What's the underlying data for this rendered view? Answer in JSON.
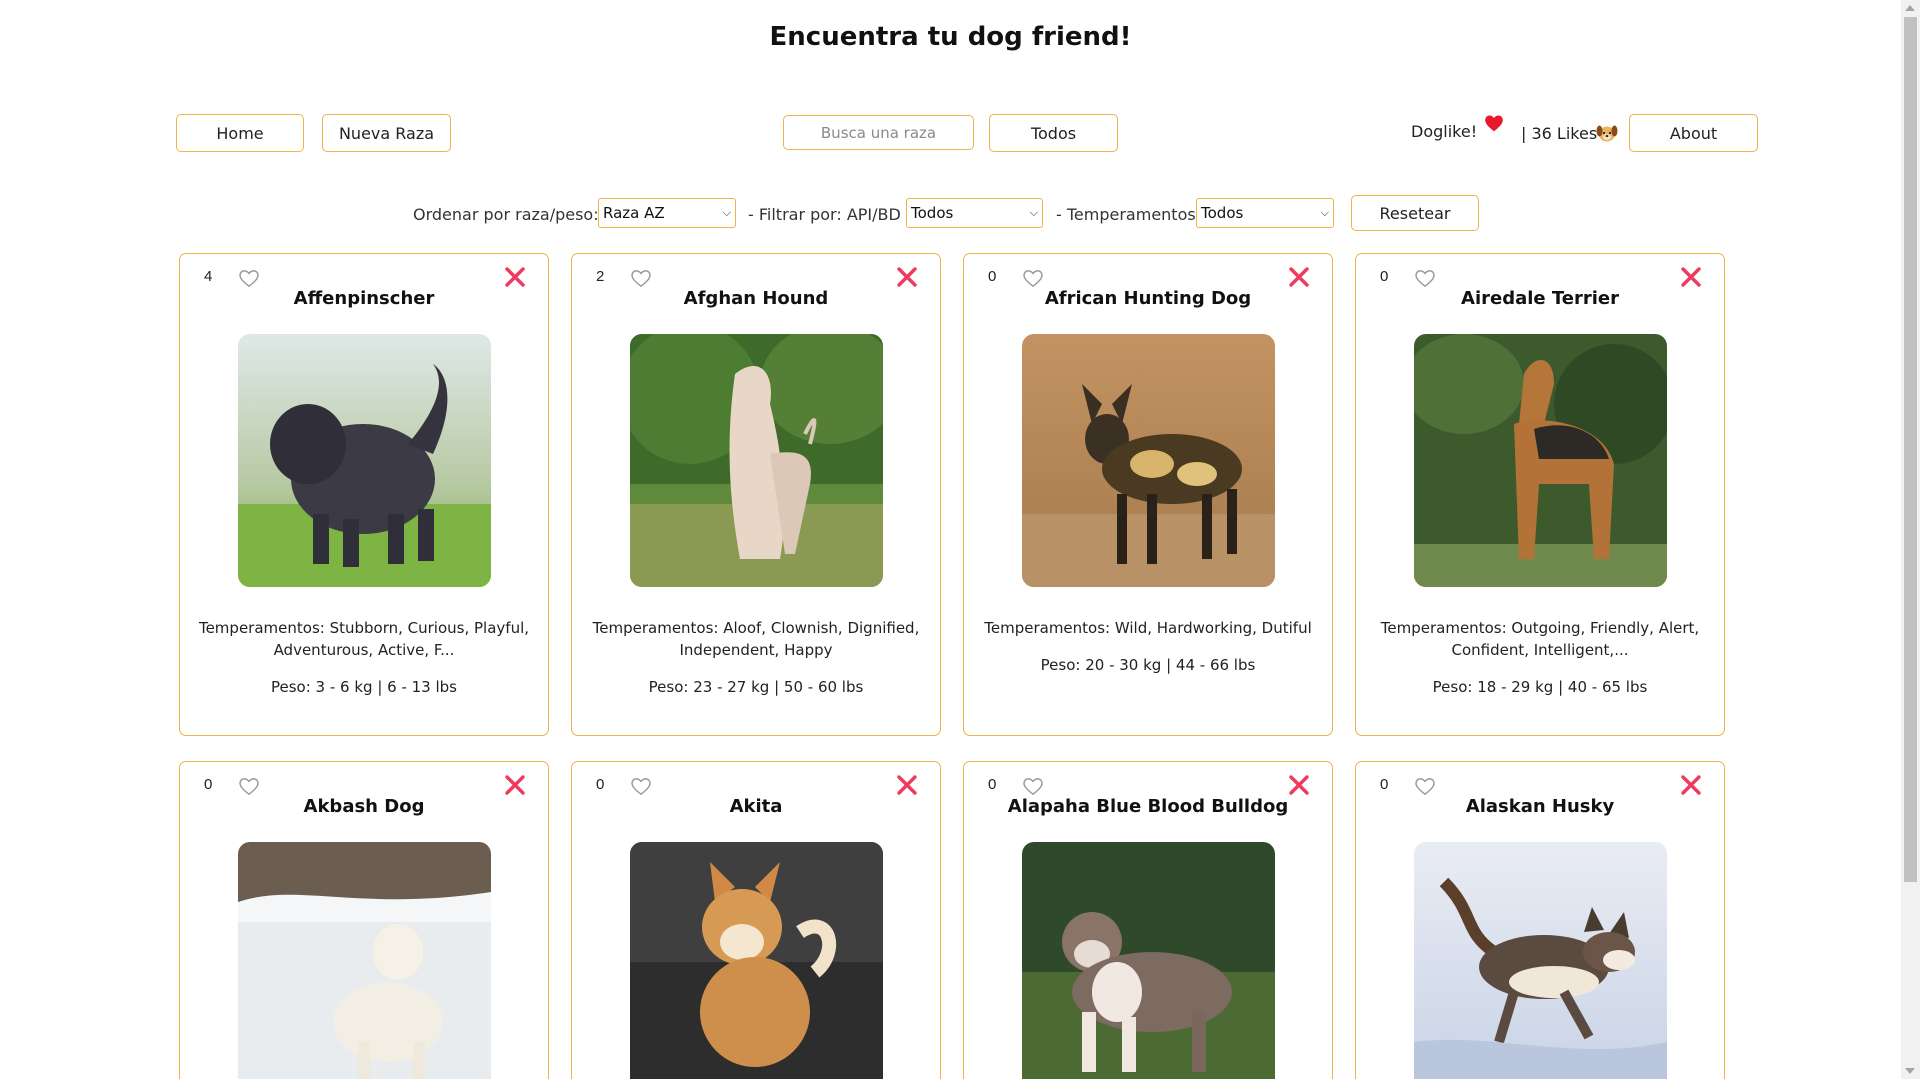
{
  "header": {
    "title": "Encuentra tu dog friend!"
  },
  "nav": {
    "home_label": "Home",
    "nueva_raza_label": "Nueva Raza",
    "search_placeholder": "Busca una raza",
    "todos_label": "Todos",
    "doglike_label": "Doglike!",
    "likes_text": "| 36 Likes",
    "about_label": "About"
  },
  "filters": {
    "order_label": "Ordenar por raza/peso:",
    "order_value": "Raza AZ",
    "source_label": "- Filtrar por: API/BD",
    "source_value": "Todos",
    "temper_label": "- Temperamentos",
    "temper_value": "Todos",
    "reset_label": "Resetear"
  },
  "cards": [
    {
      "count": "4",
      "name": "Affenpinscher",
      "temp": "Temperamentos: Stubborn, Curious, Playful, Adventurous, Active, F...",
      "peso": "Peso: 3 - 6 kg | 6 - 13 lbs",
      "image": "black shaggy affenpinscher on grass"
    },
    {
      "count": "2",
      "name": "Afghan Hound",
      "temp": "Temperamentos: Aloof, Clownish, Dignified, Independent, Happy",
      "peso": "Peso: 23 - 27 kg | 50 - 60 lbs",
      "image": "cream afghan hound in field"
    },
    {
      "count": "0",
      "name": "African Hunting Dog",
      "temp": "Temperamentos: Wild, Hardworking, Dutiful",
      "peso": "Peso: 20 - 30 kg | 44 - 66 lbs",
      "image": "spotted african wild dog in dry grass"
    },
    {
      "count": "0",
      "name": "Airedale Terrier",
      "temp": "Temperamentos: Outgoing, Friendly, Alert, Confident, Intelligent,...",
      "peso": "Peso: 18 - 29 kg | 40 - 65 lbs",
      "image": "airedale terrier in front of ivy"
    },
    {
      "count": "0",
      "name": "Akbash Dog",
      "image": "white akbash dog in snow"
    },
    {
      "count": "0",
      "name": "Akita",
      "image": "red akita dog"
    },
    {
      "count": "0",
      "name": "Alapaha Blue Blood Bulldog",
      "image": "brown and white bulldog"
    },
    {
      "count": "0",
      "name": "Alaskan Husky",
      "image": "husky running in snow"
    }
  ],
  "colors": {
    "accent_border": "#f0b24a",
    "close_x": "#ef3a5d",
    "like_heart": "#e8192c"
  }
}
